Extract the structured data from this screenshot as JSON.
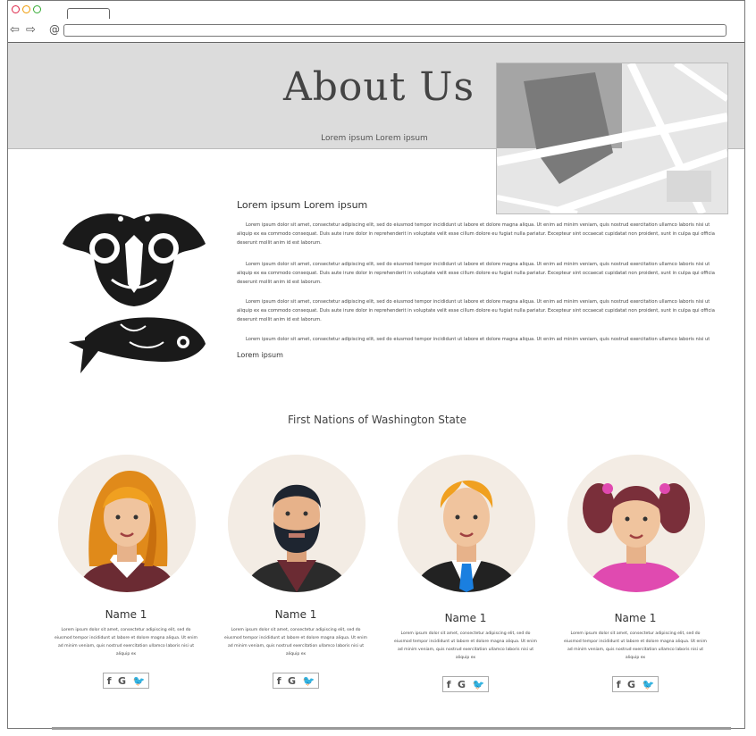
{
  "hero": {
    "title": "About Us",
    "subtitle": "Lorem ipsum Lorem ipsum"
  },
  "about": {
    "heading": "Lorem ipsum Lorem ipsum",
    "paragraphs": [
      "Lorem ipsum dolor sit amet, consectetur adipiscing elit, sed do eiusmod tempor incididunt ut labore et dolore magna aliqua. Ut enim ad minim veniam, quis nostrud exercitation ullamco laboris nisi ut aliquip ex ea commodo consequat. Duis aute irure dolor in reprehenderit in voluptate velit esse cillum dolore eu fugiat nulla pariatur. Excepteur sint occaecat cupidatat non proident, sunt in culpa qui officia deserunt mollit anim id est laborum.",
      "Lorem ipsum dolor sit amet, consectetur adipiscing elit, sed do eiusmod tempor incididunt ut labore et dolore magna aliqua. Ut enim ad minim veniam, quis nostrud exercitation ullamco laboris nisi ut aliquip ex ea commodo consequat. Duis aute irure dolor in reprehenderit in voluptate velit esse cillum dolore eu fugiat nulla pariatur. Excepteur sint occaecat cupidatat non proident, sunt in culpa qui officia deserunt mollit anim id est laborum.",
      "Lorem ipsum dolor sit amet, consectetur adipiscing elit, sed do eiusmod tempor incididunt ut labore et dolore magna aliqua. Ut enim ad minim veniam, quis nostrud exercitation ullamco laboris nisi ut aliquip ex ea commodo consequat. Duis aute irure dolor in reprehenderit in voluptate velit esse cillum dolore eu fugiat nulla pariatur. Excepteur sint occaecat cupidatat non proident, sunt in culpa qui officia deserunt mollit anim id est laborum.",
      "Lorem ipsum dolor sit amet, consectetur adipiscing elit, sed do eiusmod tempor incididunt ut labore et dolore magna aliqua. Ut enim ad minim veniam, quis nostrud exercitation ullamco laboris nisi ut aliquip ex ea commodo consequat."
    ],
    "footer": "Lorem ipsum"
  },
  "section": {
    "title": "First Nations of Washington State"
  },
  "members": [
    {
      "name": "Name 1",
      "bio": "Lorem ipsum dolor sit amet, consectetur adipiscing elit, sed do eiusmod tempor incididunt ut labore et dolore magna aliqua. Ut enim ad minim veniam, quis nostrud exercitation ullamco laboris nisi ut aliquip ex"
    },
    {
      "name": "Name 1",
      "bio": "Lorem ipsum dolor sit amet, consectetur adipiscing elit, sed do eiusmod tempor incididunt ut labore et dolore magna aliqua. Ut enim ad minim veniam, quis nostrud exercitation ullamco laboris nisi ut aliquip ex"
    },
    {
      "name": "Name 1",
      "bio": "Lorem ipsum dolor sit amet, consectetur adipiscing elit, sed do eiusmod tempor incididunt ut labore et dolore magna aliqua. Ut enim ad minim veniam, quis nostrud exercitation ullamco laboris nisi ut aliquip ex"
    },
    {
      "name": "Name 1",
      "bio": "Lorem ipsum dolor sit amet, consectetur adipiscing elit, sed do eiusmod tempor incididunt ut labore et dolore magna aliqua. Ut enim ad minim veniam, quis nostrud exercitation ullamco laboris nisi ut aliquip ex"
    }
  ],
  "social": {
    "facebook": "f",
    "google": "G",
    "twitter": "🐦"
  },
  "icons": {
    "back": "⇦",
    "forward": "⇨",
    "address": "@"
  },
  "colors": {
    "hero_bg": "#dcdcdc",
    "avatar_bg": "#f3ece4",
    "window_close": "#dd2244",
    "window_min": "#ee9900",
    "window_max": "#33aa33"
  }
}
